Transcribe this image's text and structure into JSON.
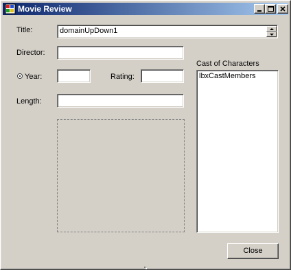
{
  "window": {
    "title": "Movie Review",
    "controls": {
      "minimize": "minimize-icon",
      "maximize": "maximize-icon",
      "close": "close-icon"
    }
  },
  "form": {
    "title_label": "Title:",
    "title_value": "domainUpDown1",
    "director_label": "Director:",
    "director_value": "",
    "year_label": "Year:",
    "year_value": "",
    "rating_label": "Rating:",
    "rating_value": "",
    "length_label": "Length:",
    "length_value": ""
  },
  "cast": {
    "label": "Cast of Characters",
    "items": [
      "lbxCastMembers"
    ]
  },
  "buttons": {
    "close_label": "Close"
  },
  "colors": {
    "title_gradient_start": "#0a246a",
    "title_gradient_end": "#a6caf0",
    "window_bg": "#d4d0c8"
  }
}
